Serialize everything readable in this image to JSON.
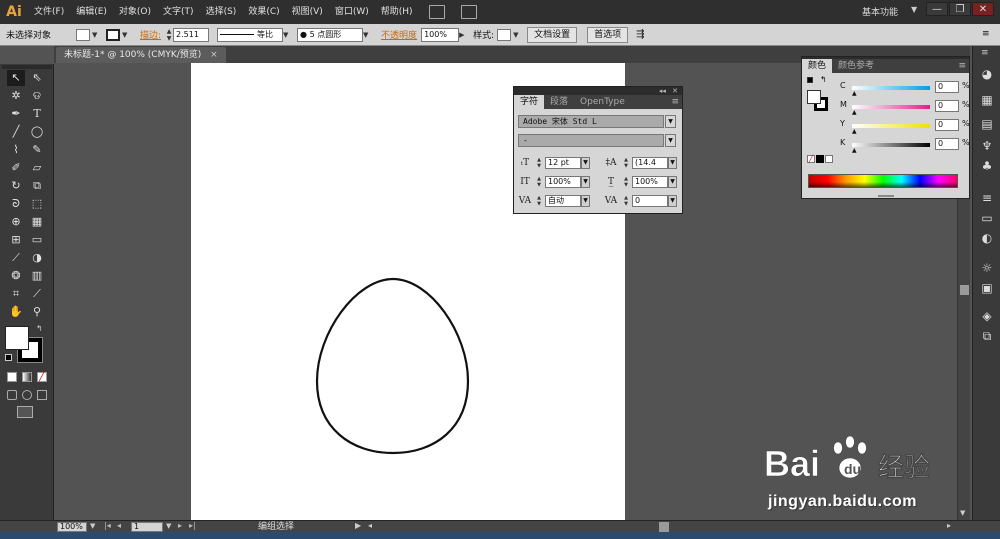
{
  "app": {
    "logo": "Ai",
    "menu": [
      "文件(F)",
      "编辑(E)",
      "对象(O)",
      "文字(T)",
      "选择(S)",
      "效果(C)",
      "视图(V)",
      "窗口(W)",
      "帮助(H)"
    ],
    "workspace": "基本功能",
    "window_buttons": [
      "—",
      "❐",
      "✕"
    ]
  },
  "control_bar": {
    "selection": "未选择对象",
    "stroke_label": "描边:",
    "stroke_value": "2.511",
    "stroke_profile": "等比",
    "brush": "5 点圆形",
    "opacity_label": "不透明度",
    "opacity_value": "100%",
    "style_label": "样式:",
    "doc_setup": "文档设置",
    "preferences": "首选项"
  },
  "document": {
    "tab_title": "未标题-1* @ 100% (CMYK/预览)",
    "close": "×"
  },
  "character_panel": {
    "tabs": [
      "字符",
      "段落",
      "OpenType"
    ],
    "active_tab": "字符",
    "font_family": "Adobe 宋体 Std L",
    "font_style": "-",
    "font_size": "12 pt",
    "leading": "(14.4",
    "vertical_scale": "100%",
    "horizontal_scale": "100%",
    "kerning": "自动",
    "tracking": "0",
    "collapse": "◂◂",
    "close": "✕"
  },
  "color_panel": {
    "tabs": [
      "颜色",
      "颜色参考"
    ],
    "active_tab": "颜色",
    "channels": [
      {
        "label": "C",
        "value": "0",
        "unit": "%",
        "gradient": "linear-gradient(to right, #ffffff, #00a0e0)"
      },
      {
        "label": "M",
        "value": "0",
        "unit": "%",
        "gradient": "linear-gradient(to right, #ffffff, #e0208a)"
      },
      {
        "label": "Y",
        "value": "0",
        "unit": "%",
        "gradient": "linear-gradient(to right, #ffffff, #f0e000)"
      },
      {
        "label": "K",
        "value": "0",
        "unit": "%",
        "gradient": "linear-gradient(to right, #ffffff, #000000)"
      }
    ]
  },
  "status_bar": {
    "zoom": "100%",
    "artboard_number": "1",
    "status_text": "编组选择"
  },
  "watermark": {
    "brand": "Bai",
    "brand_cn": "经验",
    "url": "jingyan.baidu.com"
  },
  "colors": {
    "menu_bg": "#2f2f2f",
    "control_bg": "#d4d4d4",
    "canvas_bg": "#535353",
    "accent_orange": "#c8690b"
  }
}
